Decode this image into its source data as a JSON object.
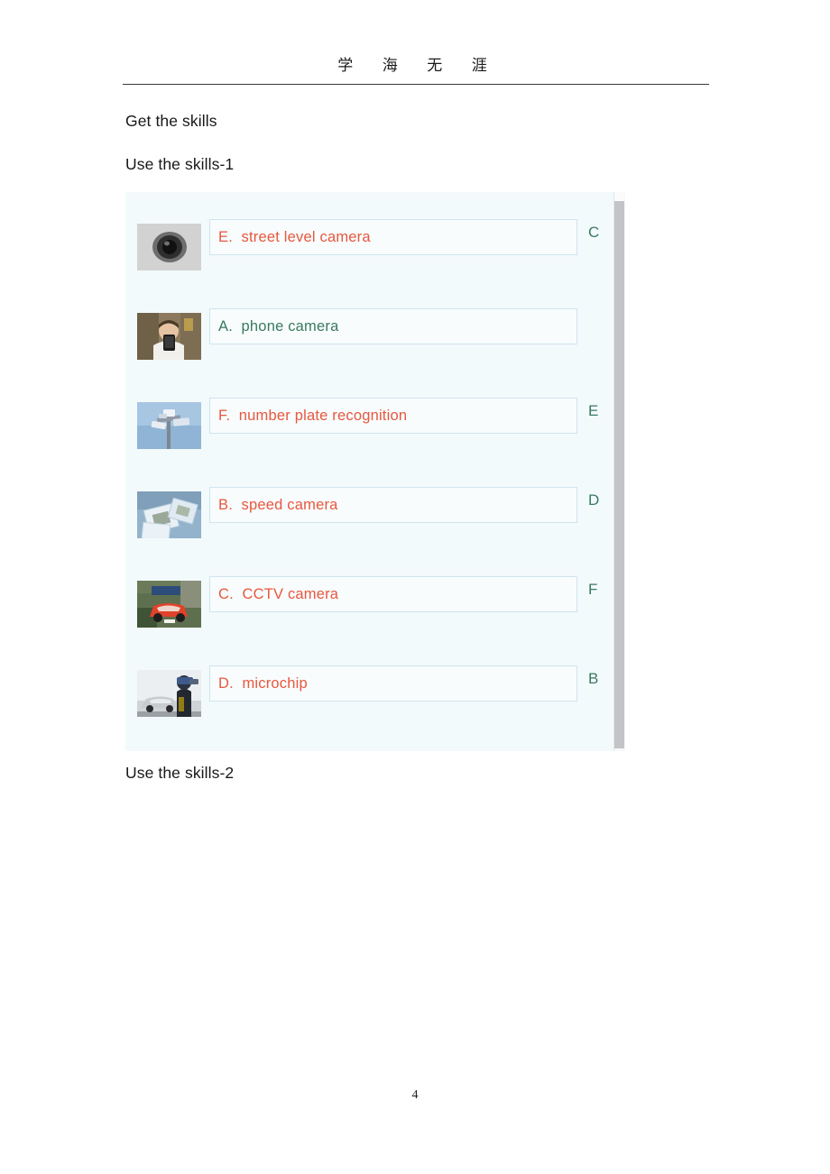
{
  "header": {
    "watermark": "学  海  无  涯"
  },
  "headings": {
    "get_the_skills": "Get the skills",
    "use_the_skills_1": "Use the skills-1",
    "use_the_skills_2": "Use the skills-2"
  },
  "colors": {
    "answer_incorrect": "#e8573d",
    "answer_correct": "#3a7a5f",
    "panel_background": "#f3fafc",
    "box_border": "#cfe4ee",
    "letter": "#3a7a5f",
    "scrollbar_thumb": "#c2c4c6"
  },
  "quiz": {
    "rows": [
      {
        "thumbnail": "dome-camera-photo",
        "answer": "E.  street level camera",
        "answer_state": "incorrect",
        "correct_letter": "C"
      },
      {
        "thumbnail": "person-with-phone-photo",
        "answer": "A.  phone camera",
        "answer_state": "correct",
        "correct_letter": ""
      },
      {
        "thumbnail": "cctv-pole-photo",
        "answer": "F.  number plate recognition",
        "answer_state": "incorrect",
        "correct_letter": "E"
      },
      {
        "thumbnail": "microchips-photo",
        "answer": "B.  speed camera",
        "answer_state": "incorrect",
        "correct_letter": "D"
      },
      {
        "thumbnail": "red-car-plate-photo",
        "answer": "C.  CCTV camera",
        "answer_state": "incorrect",
        "correct_letter": "F"
      },
      {
        "thumbnail": "police-speed-gun-photo",
        "answer": "D.  microchip",
        "answer_state": "incorrect",
        "correct_letter": "B"
      }
    ]
  },
  "footer": {
    "page_number": "4"
  }
}
